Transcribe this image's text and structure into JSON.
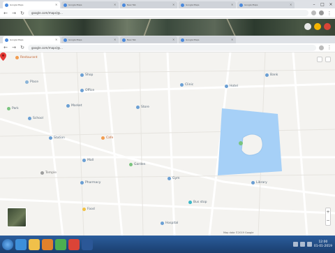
{
  "outer_browser": {
    "tabs": [
      {
        "label": "Google Maps",
        "active": true
      },
      {
        "label": "Google Maps",
        "active": false
      },
      {
        "label": "New Tab",
        "active": false
      },
      {
        "label": "Google Maps",
        "active": false
      },
      {
        "label": "Google Maps",
        "active": false
      }
    ],
    "address": "google.com/maps/@..."
  },
  "inner_browser": {
    "tabs": [
      {
        "label": "Google Maps",
        "active": true
      },
      {
        "label": "Google Maps",
        "active": false
      },
      {
        "label": "New Tab",
        "active": false
      },
      {
        "label": "Google Maps",
        "active": false
      }
    ],
    "address": "google.com/maps/@..."
  },
  "map": {
    "pois": [
      {
        "label": "Place",
        "color": "#8ab4d8"
      },
      {
        "label": "Restaurant",
        "color": "#f29c50"
      },
      {
        "label": "Shop",
        "color": "#6a9fd4"
      },
      {
        "label": "Office",
        "color": "#6a9fd4"
      },
      {
        "label": "Park",
        "color": "#7ac47f"
      },
      {
        "label": "Market",
        "color": "#6a9fd4"
      },
      {
        "label": "School",
        "color": "#6a9fd4"
      },
      {
        "label": "Store",
        "color": "#6a9fd4"
      },
      {
        "label": "Clinic",
        "color": "#6a9fd4"
      },
      {
        "label": "Hotel",
        "color": "#6a9fd4"
      },
      {
        "label": "Bank",
        "color": "#6a9fd4"
      },
      {
        "label": "Cafe",
        "color": "#f29c50"
      },
      {
        "label": "Station",
        "color": "#6a9fd4"
      },
      {
        "label": "Mall",
        "color": "#6a9fd4"
      },
      {
        "label": "Temple",
        "color": "#9e9e9e"
      },
      {
        "label": "Garden",
        "color": "#7ac47f"
      },
      {
        "label": "Pharmacy",
        "color": "#6a9fd4"
      },
      {
        "label": "Gym",
        "color": "#6a9fd4"
      },
      {
        "label": "Library",
        "color": "#6a9fd4"
      },
      {
        "label": "Bus stop",
        "color": "#3ab7c7"
      },
      {
        "label": "Food",
        "color": "#f2c244"
      },
      {
        "label": "Hospital",
        "color": "#6a9fd4"
      }
    ],
    "highlight_color": "#a6d0f7",
    "pin_color": "#e53935",
    "footer": "Map data ©2019 Google"
  },
  "taskbar": {
    "clock_time": "12:00",
    "clock_date": "01-01-2019",
    "apps": [
      {
        "name": "ie-icon",
        "color": "#3d8fd9"
      },
      {
        "name": "explorer-icon",
        "color": "#f0c04a"
      },
      {
        "name": "media-icon",
        "color": "#e0812c"
      },
      {
        "name": "chrome-icon",
        "color": "#4caf50"
      },
      {
        "name": "chrome-icon-2",
        "color": "#db4437"
      },
      {
        "name": "word-icon",
        "color": "#2b5797"
      }
    ]
  }
}
